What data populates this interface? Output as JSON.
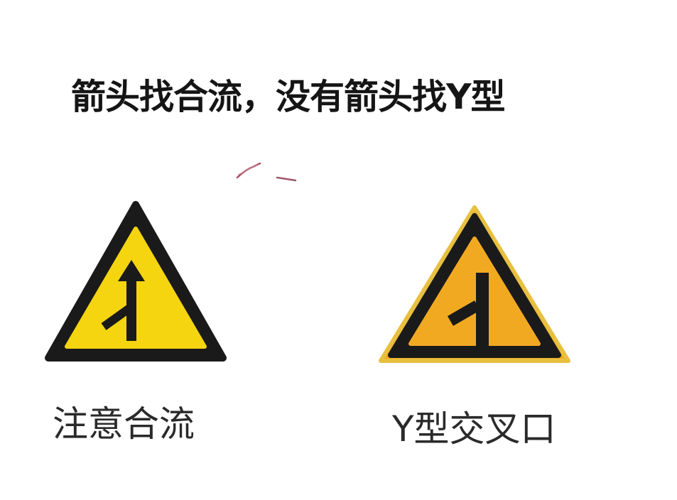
{
  "headline": "箭头找合流，没有箭头找Y型",
  "signs": [
    {
      "label": "注意合流",
      "icon": "merge-warning-sign-icon",
      "fill_color": "#F5D410",
      "border_color": "#1A1A1A"
    },
    {
      "label": "Y型交叉口",
      "icon": "y-junction-warning-sign-icon",
      "fill_color": "#F2A922",
      "border_color": "#1A1A1A"
    }
  ],
  "colors": {
    "background": "#FFFFFF",
    "text": "#151515",
    "scribble": "#B05060"
  }
}
